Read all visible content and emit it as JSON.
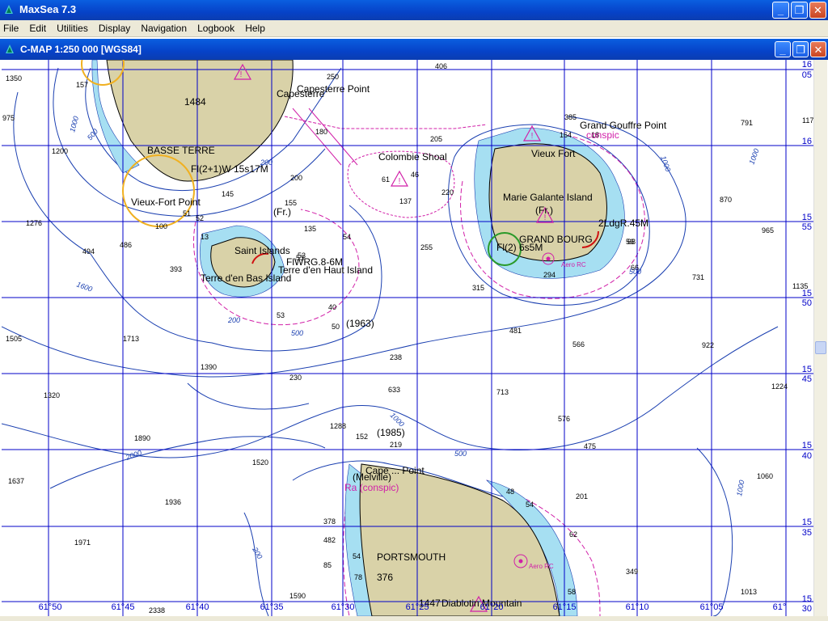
{
  "app": {
    "title": "MaxSea 7.3"
  },
  "menu": [
    "File",
    "Edit",
    "Utilities",
    "Display",
    "Navigation",
    "Logbook",
    "Help"
  ],
  "chart_window": {
    "title": "C-MAP  1:250 000 [WGS84]"
  },
  "window_controls": {
    "minimize": "_",
    "restore": "❐",
    "close": "✕"
  },
  "colors": {
    "land": "#d9d2a8",
    "shallow": "#a6dff2",
    "grid": "#0000c8",
    "contour": "#1a3fb0",
    "magenta": "#d11fa8"
  },
  "place_names": {
    "capesterre_point": "Capesterre Point",
    "capesterre": "Capesterre",
    "basse_terre": "BASSE TERRE",
    "light_basse_terre": "Fl(2+1)W 15s17M",
    "vieux_fort_point": "Vieux-Fort Point",
    "colombie_shoal": "Colombie Shoal",
    "grand_gouffre_point": "Grand Gouffre Point",
    "conspic_1": "conspic",
    "vieux_fort": "Vieux Fort",
    "marie_galante": "Marie Galante Island",
    "fr_1": "(Fr.)",
    "grand_bourg": "GRAND BOURG",
    "light_mg_2": "2LdgR.45M",
    "light_mg_1": "Fl(2) 6s5M",
    "aero_rc_1": "Aero RC",
    "fr_2": "(Fr.)",
    "saint_islands": "Saint Islands",
    "light_saints": "FlWRG.8-6M",
    "terre_haut": "Terre d'en Haut Island",
    "terre_bas": "Terre d'en Bas Island",
    "year_1963": "(1963)",
    "year_1985": "(1985)",
    "cape_point": "Cape ... Point",
    "melville": "(Melville)",
    "ra_conspic": "Ra (conspic)",
    "portsmouth": "PORTSMOUTH",
    "aero_rc_2": "Aero RC",
    "diablotin": "Diablotin Mountain",
    "height_1484": "1484",
    "height_376": "376",
    "height_1447": "1447"
  },
  "soundings": [
    "1350",
    "157",
    "975",
    "1200",
    "1276",
    "494",
    "486",
    "393",
    "1505",
    "1713",
    "1390",
    "1320",
    "1890",
    "1637",
    "1936",
    "1971",
    "2338",
    "1520",
    "1288",
    "152",
    "219",
    "378",
    "482",
    "54",
    "1590",
    "250",
    "406",
    "205",
    "180",
    "200",
    "145",
    "61",
    "46",
    "137",
    "220",
    "255",
    "315",
    "385",
    "164",
    "18",
    "870",
    "965",
    "791",
    "117",
    "1135",
    "731",
    "922",
    "1224",
    "1060",
    "1013",
    "481",
    "566",
    "713",
    "633",
    "576",
    "475",
    "201",
    "62",
    "349",
    "58",
    "54",
    "48",
    "40",
    "50",
    "53",
    "53",
    "68",
    "13",
    "52",
    "155",
    "135",
    "238",
    "230",
    "100",
    "51",
    "53",
    "54",
    "56",
    "66",
    "294",
    "85",
    "78",
    "24"
  ],
  "contour_labels": [
    "1000",
    "500",
    "200",
    "1000",
    "1600",
    "200",
    "500",
    "1000",
    "2000",
    "1000",
    "500",
    "500",
    "200",
    "1000"
  ],
  "lat_labels_right": [
    {
      "min": "16",
      "deg": "05"
    },
    {
      "min": "16",
      "deg": ""
    },
    {
      "min": "15",
      "deg": "55"
    },
    {
      "min": "15",
      "deg": "50"
    },
    {
      "min": "15",
      "deg": "45"
    },
    {
      "min": "15",
      "deg": "40"
    },
    {
      "min": "15",
      "deg": "35"
    },
    {
      "min": "15",
      "deg": "30"
    }
  ],
  "lon_labels_bottom": [
    "61°50",
    "61°45",
    "61°40",
    "61°35",
    "61°30",
    "61°25",
    "61°20",
    "61°15",
    "61°10",
    "61°05",
    "61°"
  ]
}
